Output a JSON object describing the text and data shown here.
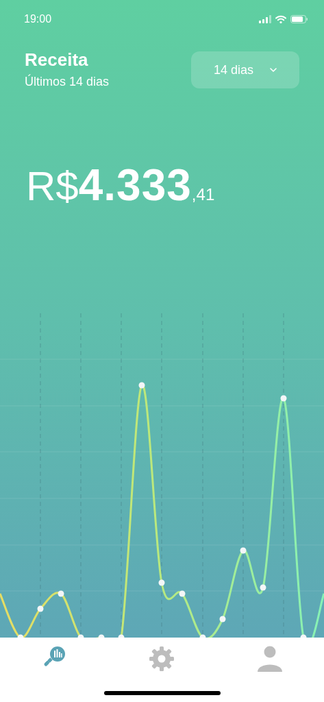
{
  "status_bar": {
    "time": "19:00"
  },
  "header": {
    "title": "Receita",
    "subtitle": "Últimos 14 dias"
  },
  "period_picker": {
    "value": "14 dias"
  },
  "total": {
    "currency": "R$",
    "integer": "4.333",
    "cents": ",41"
  },
  "tab_bar": [
    {
      "kind": "analytics",
      "selected": true
    },
    {
      "kind": "settings",
      "selected": false
    },
    {
      "kind": "profile",
      "selected": false
    }
  ]
}
